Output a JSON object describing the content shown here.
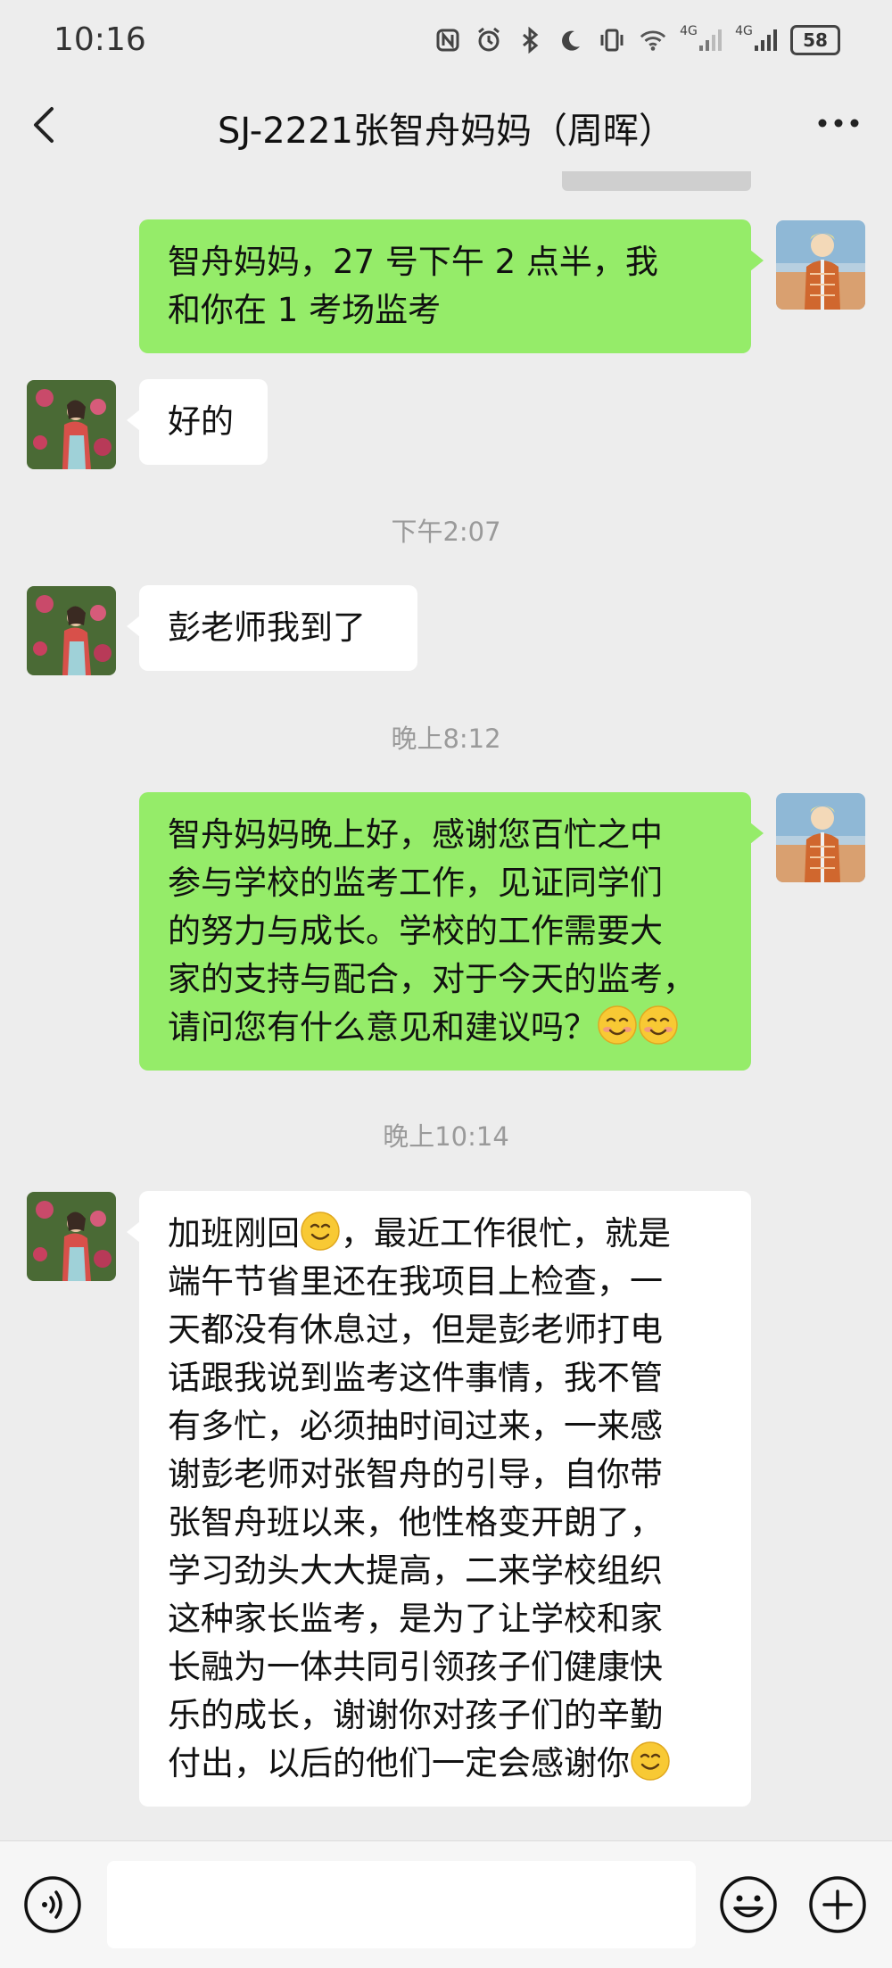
{
  "status_bar": {
    "time": "10:16",
    "network_1": "4G",
    "network_2": "4G",
    "battery": "58"
  },
  "header": {
    "title": "SJ-2221张智舟妈妈（周晖）"
  },
  "messages": [
    {
      "sender": "me",
      "lines": [
        "智舟妈妈，27 号下午 2 点半，我",
        "和你在 1 考场监考"
      ]
    },
    {
      "sender": "other",
      "lines": [
        "好的"
      ]
    },
    {
      "timestamp": "下午2:07"
    },
    {
      "sender": "other",
      "lines": [
        "彭老师我到了"
      ]
    },
    {
      "timestamp": "晚上8:12"
    },
    {
      "sender": "me",
      "lines": [
        "智舟妈妈晚上好，感谢您百忙之中",
        "参与学校的监考工作，见证同学们",
        "的努力与成长。学校的工作需要大",
        "家的支持与配合，对于今天的监考，",
        "请问您有什么意见和建议吗？"
      ]
    },
    {
      "timestamp": "晚上10:14"
    },
    {
      "sender": "other",
      "lines": [
        "加班刚回",
        "，最近工作很忙，就是",
        "端午节省里还在我项目上检查，一",
        "天都没有休息过，但是彭老师打电",
        "话跟我说到监考这件事情，我不管",
        "有多忙，必须抽时间过来，一来感",
        "谢彭老师对张智舟的引导，自你带",
        "张智舟班以来，他性格变开朗了，",
        "学习劲头大大提高，二来学校组织",
        "这种家长监考，是为了让学校和家",
        "长融为一体共同引领孩子们健康快",
        "乐的成长，谢谢你对孩子们的辛勤",
        "付出，以后的他们一定会感谢你"
      ]
    }
  ],
  "colors": {
    "my_bubble": "#95ec69",
    "other_bubble": "#ffffff",
    "background": "#ededed"
  },
  "icons": [
    "back-icon",
    "more-icon",
    "voice-icon",
    "emoji-icon",
    "plus-icon",
    "smile-emoji-icon"
  ]
}
